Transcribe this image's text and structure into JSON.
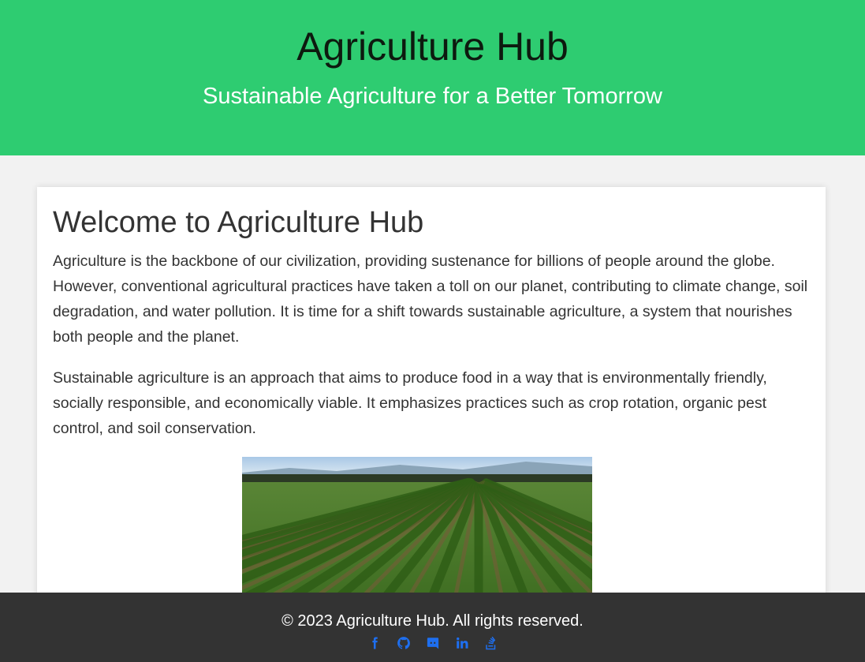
{
  "header": {
    "title": "Agriculture Hub",
    "tagline": "Sustainable Agriculture for a Better Tomorrow"
  },
  "main": {
    "heading": "Welcome to Agriculture Hub",
    "paragraphs": [
      "Agriculture is the backbone of our civilization, providing sustenance for billions of people around the globe. However, conventional agricultural practices have taken a toll on our planet, contributing to climate change, soil degradation, and water pollution. It is time for a shift towards sustainable agriculture, a system that nourishes both people and the planet.",
      "Sustainable agriculture is an approach that aims to produce food in a way that is environmentally friendly, socially responsible, and economically viable. It emphasizes practices such as crop rotation, organic pest control, and soil conservation."
    ],
    "image_icon": "crop-field-photo"
  },
  "footer": {
    "copyright": "© 2023 Agriculture Hub. All rights reserved.",
    "social_links": [
      {
        "icon": "facebook-icon"
      },
      {
        "icon": "github-icon"
      },
      {
        "icon": "discord-icon"
      },
      {
        "icon": "linkedin-icon"
      },
      {
        "icon": "stackoverflow-icon"
      }
    ]
  },
  "colors": {
    "header_bg": "#2ecc71",
    "page_bg": "#f2f2f2",
    "card_bg": "#ffffff",
    "footer_bg": "#333333",
    "social_icon": "#1e6ff0",
    "text": "#333333"
  }
}
